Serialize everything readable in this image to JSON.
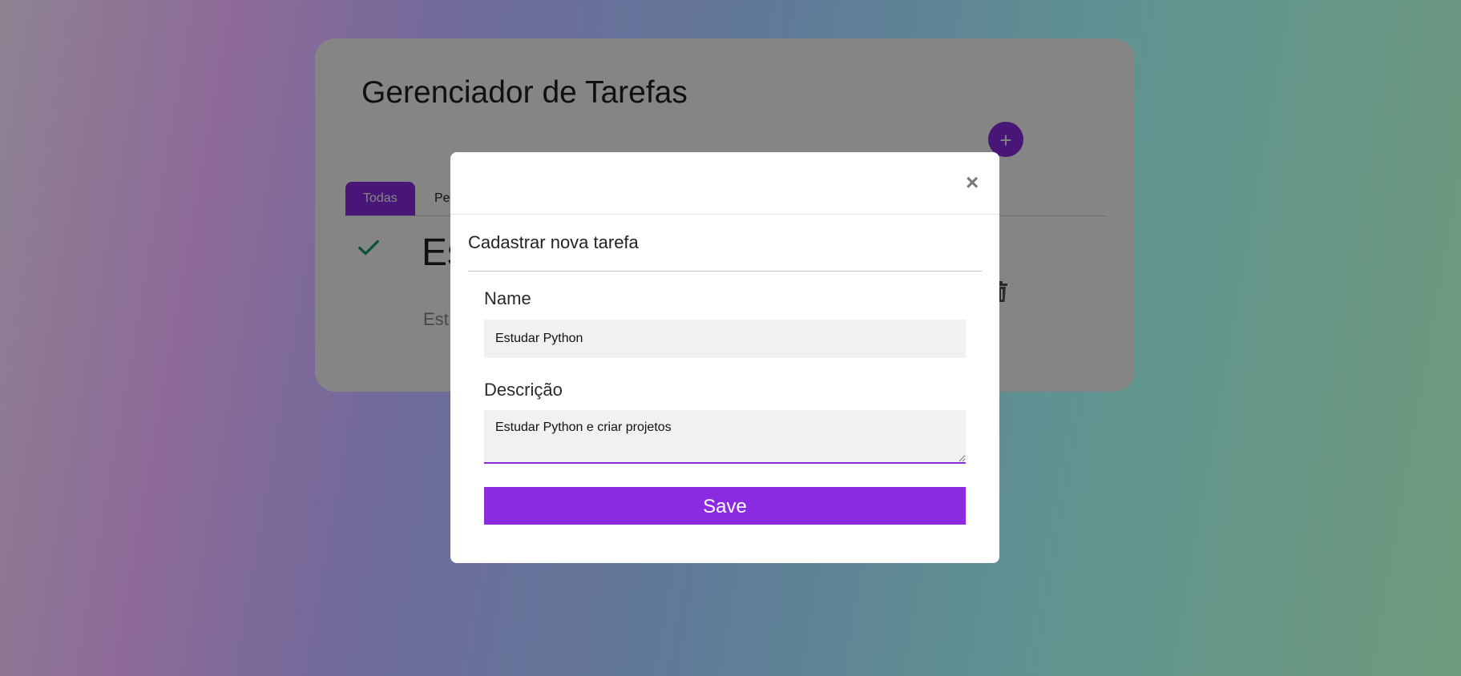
{
  "app": {
    "title": "Gerenciador de Tarefas",
    "add_button_label": "+"
  },
  "tabs": [
    {
      "label": "Todas",
      "active": true
    },
    {
      "label": "Pe",
      "active": false
    }
  ],
  "task": {
    "title": "Es",
    "description": "Est",
    "completed": true
  },
  "modal": {
    "close_label": "×",
    "title": "Cadastrar nova tarefa",
    "name_label": "Name",
    "name_value": "Estudar Python",
    "description_label": "Descrição",
    "description_value": "Estudar Python e criar projetos",
    "save_label": "Save"
  },
  "icons": {
    "check": "check-icon",
    "trash": "trash-icon",
    "close": "close-icon"
  },
  "colors": {
    "accent": "#8a2be2",
    "check": "#1a9a6a"
  }
}
